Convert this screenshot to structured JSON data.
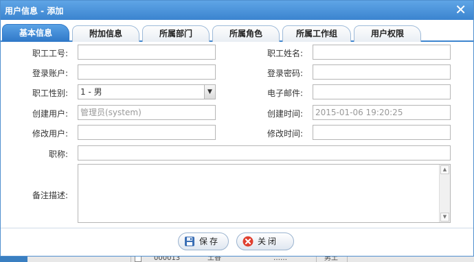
{
  "window": {
    "title": "用户信息 - 添加",
    "close_glyph": "✕"
  },
  "tabs": [
    {
      "label": "基本信息",
      "active": true
    },
    {
      "label": "附加信息",
      "active": false
    },
    {
      "label": "所属部门",
      "active": false
    },
    {
      "label": "所属角色",
      "active": false
    },
    {
      "label": "所属工作组",
      "active": false
    },
    {
      "label": "用户权限",
      "active": false
    }
  ],
  "form": {
    "employee_no": {
      "label": "职工工号:",
      "value": ""
    },
    "employee_name": {
      "label": "职工姓名:",
      "value": ""
    },
    "login_account": {
      "label": "登录账户:",
      "value": ""
    },
    "login_password": {
      "label": "登录密码:",
      "value": ""
    },
    "gender": {
      "label": "职工性别:",
      "value": "1 - 男"
    },
    "email": {
      "label": "电子邮件:",
      "value": ""
    },
    "creator": {
      "label": "创建用户:",
      "value": "管理员(system)"
    },
    "created_time": {
      "label": "创建时间:",
      "value": "2015-01-06 19:20:25"
    },
    "modifier": {
      "label": "修改用户:",
      "value": ""
    },
    "modified_time": {
      "label": "修改时间:",
      "value": ""
    },
    "job_title": {
      "label": "职称:",
      "value": ""
    },
    "remarks": {
      "label": "备注描述:",
      "value": ""
    }
  },
  "buttons": {
    "save": "保存",
    "close": "关闭"
  },
  "background_row": {
    "code": "000013",
    "col2": "土香",
    "col3": "……",
    "col4": "男土"
  },
  "colors": {
    "accent": "#3b84cf",
    "title_bar": "#4a94dc",
    "close_icon": "#e04030"
  }
}
